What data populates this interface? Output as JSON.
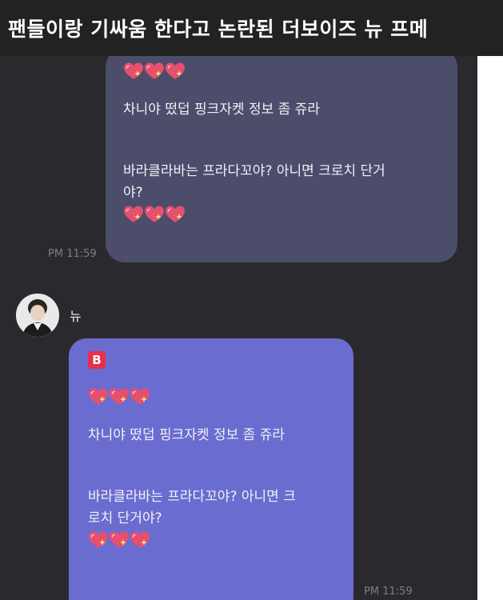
{
  "caption": {
    "title": "팬들이랑 기싸움 한다고 논란된 더보이즈 뉴 프메"
  },
  "chat": {
    "message_1": {
      "line_1": "차니야 떴덥 핑크자켓 정보 좀 쥬라",
      "line_2": "바라클라바는 프라다꼬야? 아니면 크로치 단거",
      "line_3": "야?",
      "timestamp": "PM 11:59"
    },
    "sender": {
      "name": "뉴"
    },
    "message_2": {
      "badge": "B",
      "line_1": "차니야 떴덥 핑크자켓 정보 좀 쥬라",
      "line_2": "바라클라바는 프라다꼬야? 아니면 크",
      "line_3": "로치 단거야?",
      "timestamp": "PM 11:59"
    }
  },
  "colors": {
    "title_bar": "#222222",
    "chat_background": "#2a2a2e",
    "bubble_received": "#4b4d6b",
    "bubble_artist": "#6b6cd0",
    "heart": "#e5506e",
    "badge": "#e8304a"
  },
  "icons": [
    "sparkle-heart-icon",
    "b-badge-icon",
    "profile-avatar"
  ]
}
